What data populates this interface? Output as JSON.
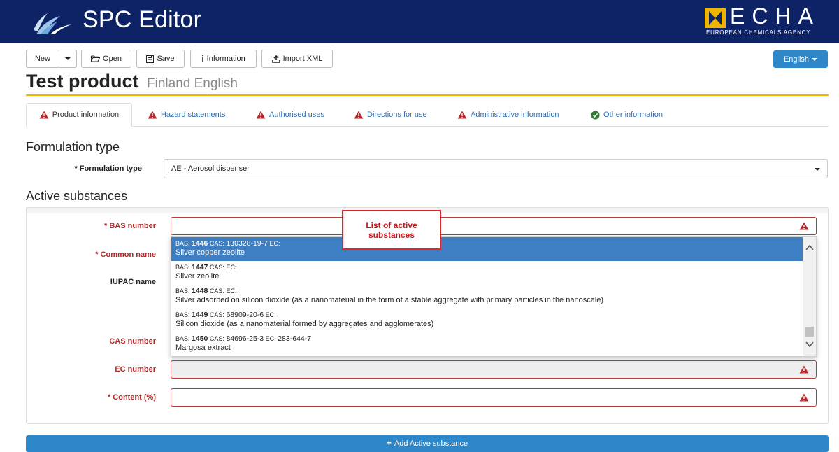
{
  "app": {
    "title": "SPC Editor",
    "logo_word": "ECHA",
    "logo_sub": "EUROPEAN CHEMICALS AGENCY"
  },
  "toolbar": {
    "new_label": "New",
    "open_label": "Open",
    "save_label": "Save",
    "information_label": "Information",
    "import_label": "Import XML",
    "language_label": "English"
  },
  "product": {
    "name": "Test product",
    "context": "Finland English"
  },
  "tabs": [
    {
      "label": "Product information",
      "status": "warning"
    },
    {
      "label": "Hazard statements",
      "status": "warning"
    },
    {
      "label": "Authorised uses",
      "status": "warning"
    },
    {
      "label": "Directions for use",
      "status": "warning"
    },
    {
      "label": "Administrative information",
      "status": "warning"
    },
    {
      "label": "Other information",
      "status": "ok"
    }
  ],
  "formulation": {
    "heading": "Formulation type",
    "label": "* Formulation type",
    "value": "AE - Aerosol dispenser"
  },
  "active": {
    "heading": "Active substances",
    "labels": {
      "bas": "* BAS number",
      "common": "* Common name",
      "iupac": "IUPAC name",
      "cas": "CAS number",
      "ec": "EC number",
      "content": "* Content (%)"
    }
  },
  "dropdown": {
    "options": [
      {
        "bas": "1446",
        "cas": "130328-19-7",
        "ec": "",
        "name": "Silver copper zeolite",
        "selected": true
      },
      {
        "bas": "1447",
        "cas": "",
        "ec": "",
        "name": "Silver zeolite",
        "selected": false
      },
      {
        "bas": "1448",
        "cas": "",
        "ec": "",
        "name": "Silver adsorbed on silicon dioxide (as a nanomaterial in the form of a stable aggregate with primary particles in the nanoscale)",
        "selected": false
      },
      {
        "bas": "1449",
        "cas": "68909-20-6",
        "ec": "",
        "name": "Silicon dioxide (as a nanomaterial formed by aggregates and agglomerates)",
        "selected": false
      },
      {
        "bas": "1450",
        "cas": "84696-25-3",
        "ec": "283-644-7",
        "name": "Margosa extract",
        "selected": false
      }
    ],
    "prefix_bas": "BAS:",
    "prefix_cas": "CAS:",
    "prefix_ec": "EC:"
  },
  "callout": {
    "text": "List of active substances"
  },
  "add_button": {
    "label": "Add Active substance"
  },
  "colors": {
    "header_bg": "#0d2366",
    "accent": "#f0b400",
    "primary": "#2e87c8",
    "error": "#b33b3b",
    "link": "#2d6db4"
  }
}
